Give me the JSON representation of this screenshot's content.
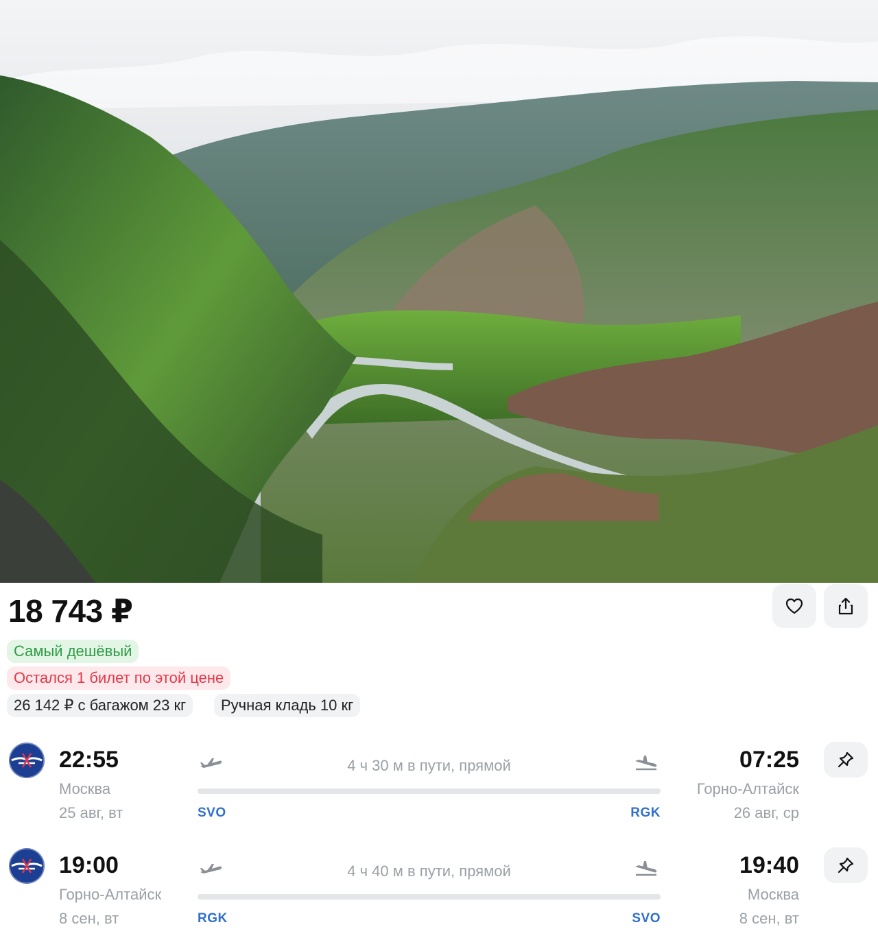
{
  "offer": {
    "price": "18 743 ₽",
    "badges": {
      "cheapest": "Самый дешёвый",
      "last_ticket": "Остался 1 билет по этой цене",
      "baggage": "26 142 ₽ с багажом 23 кг",
      "hand_luggage": "Ручная кладь 10 кг"
    }
  },
  "hero_image": "mountain-valley-photo",
  "actions": {
    "favorite_icon": "heart-icon",
    "share_icon": "share-icon"
  },
  "flights": [
    {
      "departure": {
        "time": "22:55",
        "city": "Москва",
        "date": "25 авг, вт",
        "code": "SVO"
      },
      "duration": "4 ч 30 м в пути, прямой",
      "arrival": {
        "time": "07:25",
        "city": "Горно-Алтайск",
        "date": "26 авг, ср",
        "code": "RGK"
      },
      "pin_icon": "pin-icon"
    },
    {
      "departure": {
        "time": "19:00",
        "city": "Горно-Алтайск",
        "date": "8 сен, вт",
        "code": "RGK"
      },
      "duration": "4 ч 40 м в пути, прямой",
      "arrival": {
        "time": "19:40",
        "city": "Москва",
        "date": "8 сен, вт",
        "code": "SVO"
      },
      "pin_icon": "pin-icon"
    }
  ],
  "colors": {
    "cheap_badge_bg": "#e3f6e6",
    "cheap_badge_text": "#2e9b45",
    "last_badge_bg": "#fde9ec",
    "last_badge_text": "#e2384a",
    "airport_code": "#2f6fcf",
    "airline_logo": "#1c3f94"
  }
}
